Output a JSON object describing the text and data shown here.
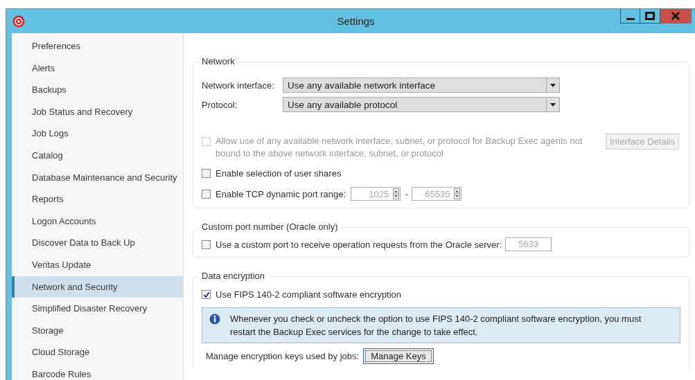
{
  "window": {
    "title": "Settings"
  },
  "sidebar": {
    "items": [
      {
        "label": "Preferences",
        "selected": false
      },
      {
        "label": "Alerts",
        "selected": false
      },
      {
        "label": "Backups",
        "selected": false
      },
      {
        "label": "Job Status and Recovery",
        "selected": false
      },
      {
        "label": "Job Logs",
        "selected": false
      },
      {
        "label": "Catalog",
        "selected": false
      },
      {
        "label": "Database Maintenance and Security",
        "selected": false
      },
      {
        "label": "Reports",
        "selected": false
      },
      {
        "label": "Logon Accounts",
        "selected": false
      },
      {
        "label": "Discover Data to Back Up",
        "selected": false
      },
      {
        "label": "Veritas Update",
        "selected": false
      },
      {
        "label": "Network and Security",
        "selected": true
      },
      {
        "label": "Simplified Disaster Recovery",
        "selected": false
      },
      {
        "label": "Storage",
        "selected": false
      },
      {
        "label": "Cloud Storage",
        "selected": false
      },
      {
        "label": "Barcode Rules",
        "selected": false
      }
    ]
  },
  "network": {
    "title": "Network",
    "fields": [
      {
        "label": "Network interface:",
        "value": "Use any available network interface"
      },
      {
        "label": "Protocol:",
        "value": "Use any available protocol"
      }
    ],
    "options": [
      {
        "kind": "checkbox",
        "label": "Allow use of any available network interface, subnet, or protocol for Backup Exec agents not bound to the above network interface, subnet, or protocol",
        "checked": false,
        "disabled": true,
        "button": "Interface Details"
      },
      {
        "kind": "checkbox",
        "label": "Enable selection of user shares",
        "checked": false,
        "disabled": false
      },
      {
        "kind": "range",
        "label": "Enable TCP dynamic port range:",
        "checked": false,
        "disabled": false,
        "from": "1025",
        "separator": "-",
        "to": "65535"
      }
    ]
  },
  "custom_port": {
    "title": "Custom port number (Oracle only)",
    "label": "Use a custom port to receive operation requests from the Oracle server:",
    "checked": false,
    "value": "5633"
  },
  "encryption": {
    "title": "Data encryption",
    "label": "Use FIPS 140-2 compliant software encryption",
    "checked": true,
    "info": "Whenever you check or uncheck the option to use FIPS 140-2 compliant software encryption, you must restart the Backup Exec services for the change to take effect.",
    "manage_label": "Manage encryption keys used by jobs:",
    "manage_button": "Manage Keys"
  }
}
